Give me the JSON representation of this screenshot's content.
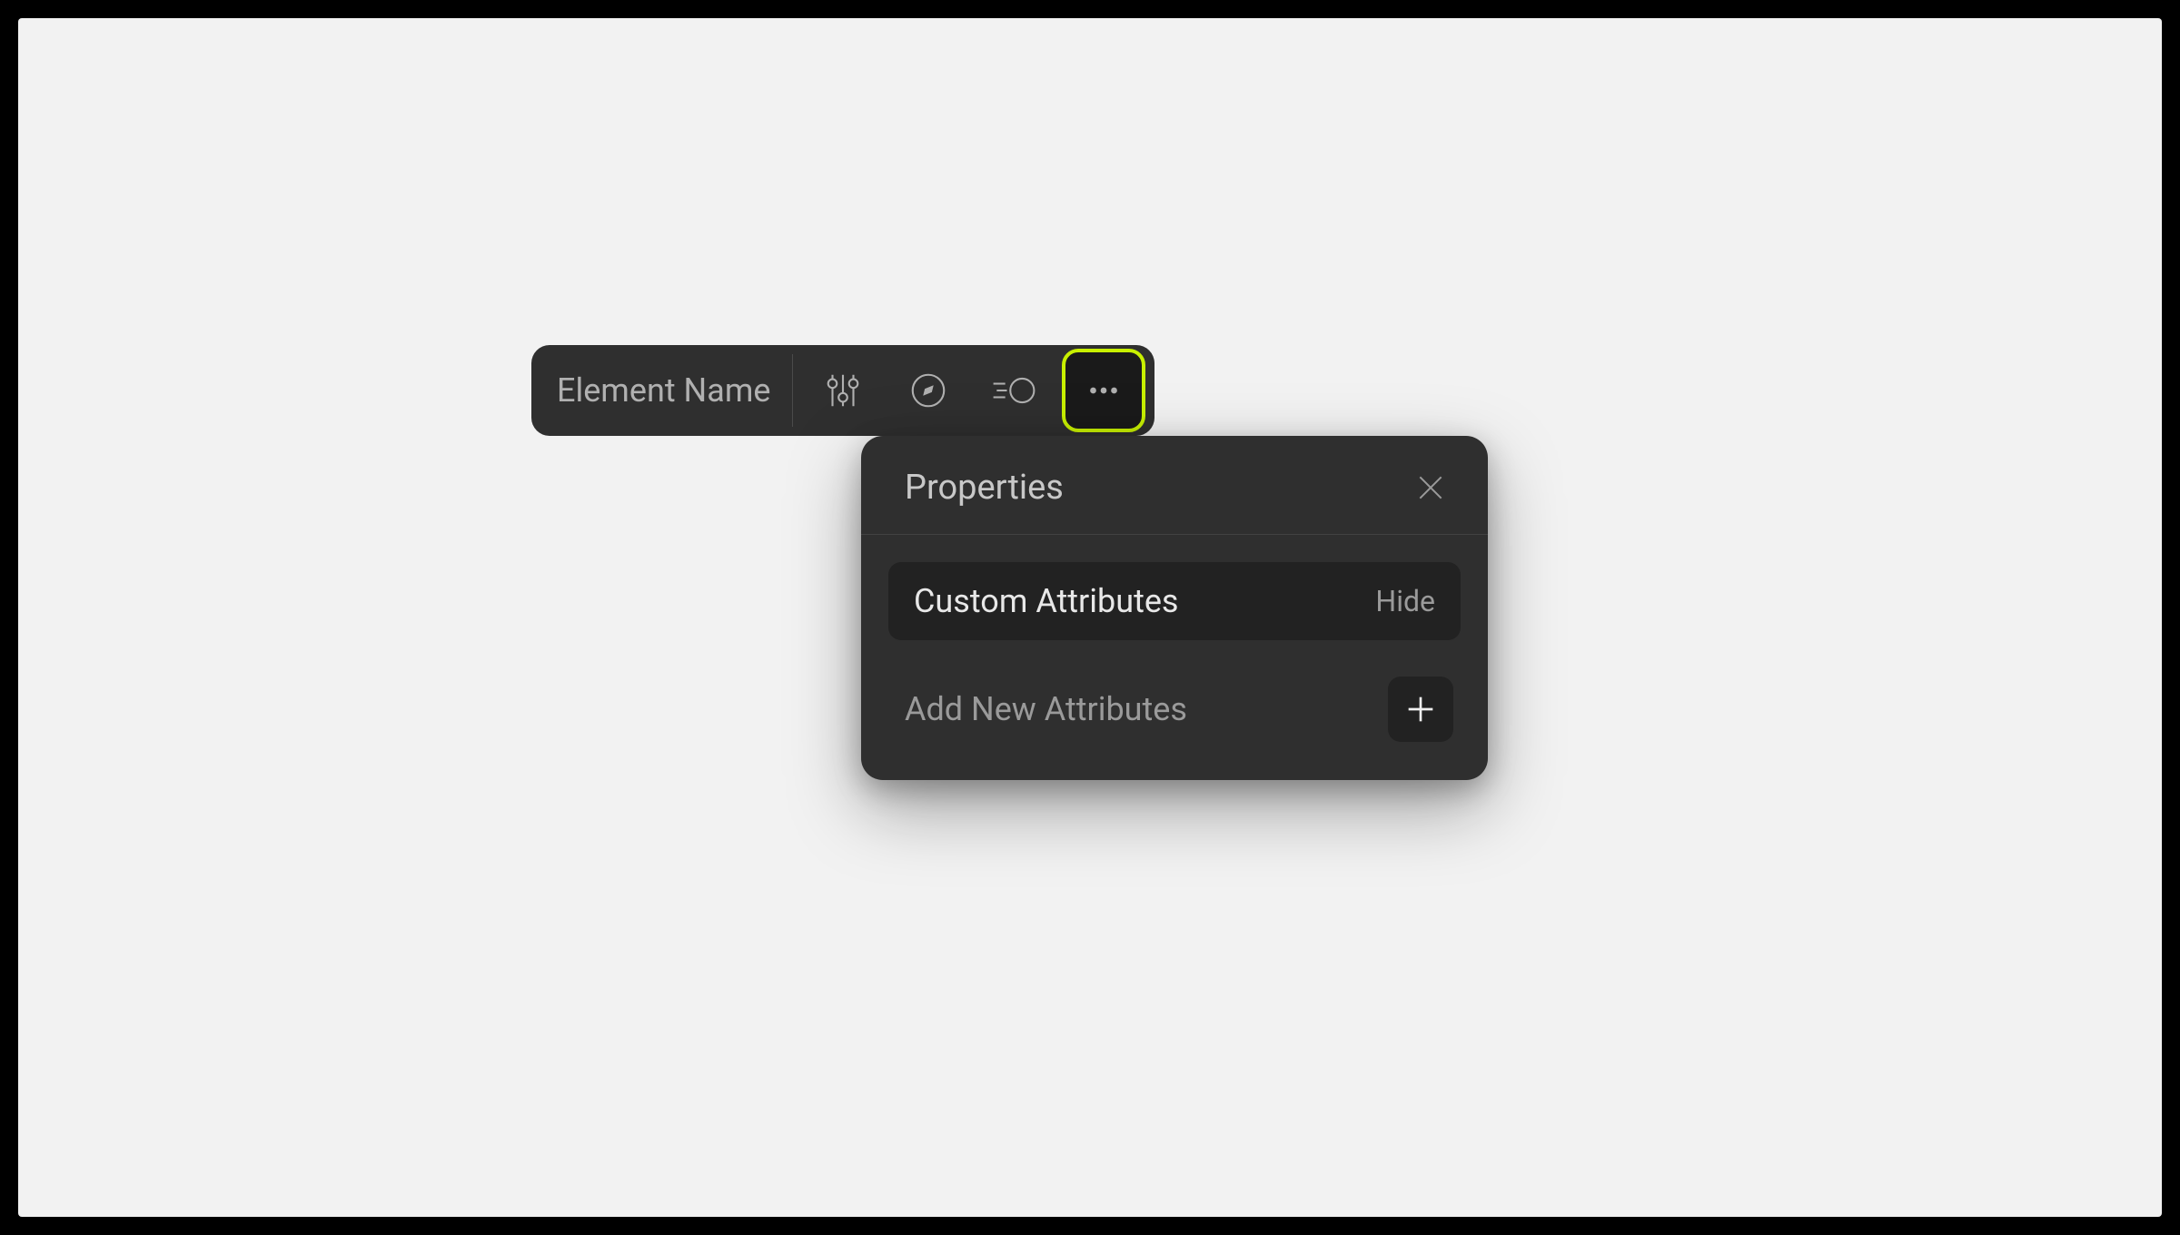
{
  "toolbar": {
    "label": "Element Name",
    "icons": {
      "sliders": "sliders-icon",
      "compass": "compass-icon",
      "motion": "motion-icon",
      "more": "more-icon"
    }
  },
  "popover": {
    "title": "Properties",
    "custom_attributes": {
      "label": "Custom Attributes",
      "toggle": "Hide"
    },
    "add_new": {
      "label": "Add New Attributes"
    }
  },
  "colors": {
    "highlight": "#c8f000",
    "panel": "#2f2f2f",
    "darkRow": "#222222"
  }
}
